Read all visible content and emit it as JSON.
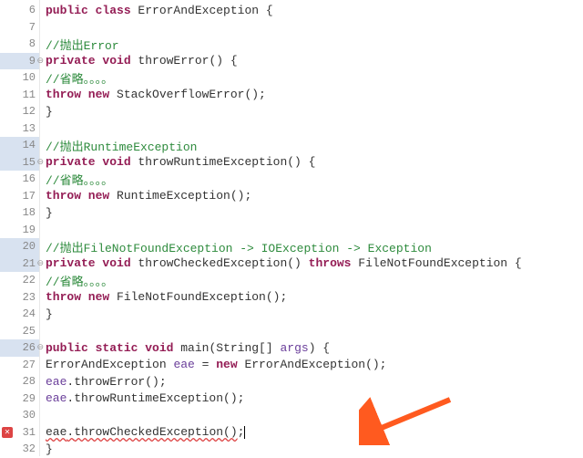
{
  "lines": {
    "l6": {
      "num": "6",
      "c1": "public class",
      "c2": " ErrorAndException {"
    },
    "l7": {
      "num": "7"
    },
    "l8": {
      "num": "8",
      "cm": "//抛出Error"
    },
    "l9": {
      "num": "9",
      "c1": "private void",
      "c2": " throwError() {"
    },
    "l10": {
      "num": "10",
      "cm": "//省略。。。。"
    },
    "l11": {
      "num": "11",
      "c1": "throw new",
      "c2": " StackOverflowError();"
    },
    "l12": {
      "num": "12",
      "c2": "}"
    },
    "l13": {
      "num": "13"
    },
    "l14": {
      "num": "14",
      "cm": "//抛出RuntimeException"
    },
    "l15": {
      "num": "15",
      "c1": "private void",
      "c2": " throwRuntimeException() {"
    },
    "l16": {
      "num": "16",
      "cm": "//省略。。。。"
    },
    "l17": {
      "num": "17",
      "c1": "throw new",
      "c2": " RuntimeException();"
    },
    "l18": {
      "num": "18",
      "c2": "}"
    },
    "l19": {
      "num": "19"
    },
    "l20": {
      "num": "20",
      "cm": "//抛出FileNotFoundException -> IOException -> Exception"
    },
    "l21": {
      "num": "21",
      "c1": "private void",
      "c2": " throwCheckedException() ",
      "c3": "throws",
      "c4": " FileNotFoundException {"
    },
    "l22": {
      "num": "22",
      "cm": "//省略。。。。"
    },
    "l23": {
      "num": "23",
      "c1": "throw new",
      "c2": " FileNotFoundException();"
    },
    "l24": {
      "num": "24",
      "c2": "}"
    },
    "l25": {
      "num": "25"
    },
    "l26": {
      "num": "26",
      "c1": "public static void",
      "c2": " main(String[] ",
      "c3": "args",
      "c4": ") {"
    },
    "l27": {
      "num": "27",
      "c2": "ErrorAndException ",
      "c3": "eae",
      "c4": " = ",
      "c5": "new",
      "c6": " ErrorAndException();"
    },
    "l28": {
      "num": "28",
      "c3": "eae",
      "c4": ".throwError();"
    },
    "l29": {
      "num": "29",
      "c3": "eae",
      "c4": ".throwRuntimeException();"
    },
    "l30": {
      "num": "30"
    },
    "l31": {
      "num": "31",
      "c3": "eae",
      "c4": ".",
      "c5": "throwCheckedException()",
      "c6": ";"
    },
    "l32": {
      "num": "32",
      "c2": "}"
    }
  },
  "arrow_color": "#ff5a1f"
}
